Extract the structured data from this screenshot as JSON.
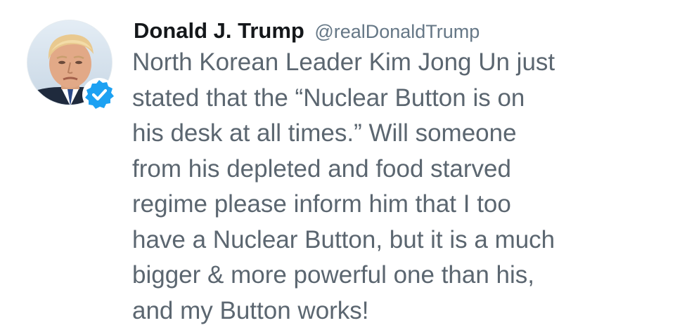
{
  "tweet": {
    "author": {
      "display_name": "Donald J. Trump",
      "handle": "@realDonaldTrump",
      "avatar": "profile-photo",
      "verified_icon": "verified-badge-icon"
    },
    "text_lines": [
      "North Korean Leader Kim Jong Un just",
      "stated that the “Nuclear Button is on",
      "his desk at all times.” Will someone",
      "from his depleted and food starved",
      "regime please inform him that I too",
      "have a Nuclear Button, but it is a much",
      "bigger & more powerful one than his,",
      "and my Button works!"
    ]
  },
  "colors": {
    "name": "#14171a",
    "handle": "#657786",
    "body_text": "#5b6670",
    "verified": "#1da1f2"
  }
}
